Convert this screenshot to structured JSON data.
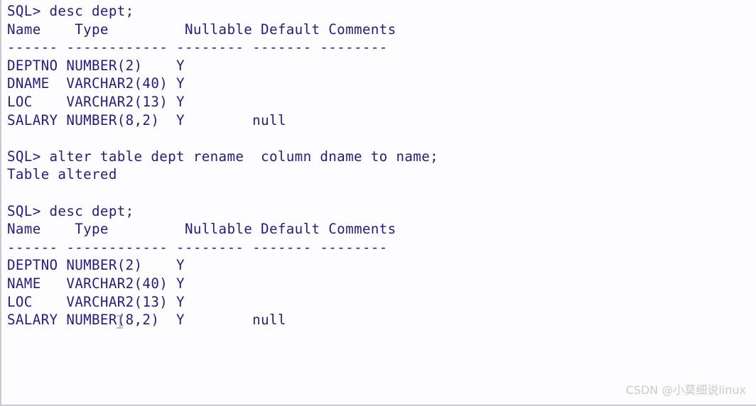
{
  "window": {
    "title": "SQL> console output",
    "background_color": "#fdfdff",
    "text_color": "#2a1a7a",
    "border_color": "#c9c9d2"
  },
  "console": {
    "prompt": "SQL>",
    "table_name": "dept",
    "columns": [
      "Name",
      "Type",
      "Nullable",
      "Default",
      "Comments"
    ],
    "blocks": [
      {
        "type": "command",
        "command": "SQL> desc dept;"
      },
      {
        "type": "describe-output",
        "header": "Name    Type         Nullable Default Comments",
        "separator": "------ ------------ -------- ------- --------",
        "rows": [
          {
            "name": "DEPTNO",
            "type": "NUMBER(2)",
            "nullable": "Y",
            "default": "",
            "comments": ""
          },
          {
            "name": "DNAME",
            "type": "VARCHAR2(40)",
            "nullable": "Y",
            "default": "",
            "comments": ""
          },
          {
            "name": "LOC",
            "type": "VARCHAR2(13)",
            "nullable": "Y",
            "default": "",
            "comments": ""
          },
          {
            "name": "SALARY",
            "type": "NUMBER(8,2)",
            "nullable": "Y",
            "default": "null",
            "comments": ""
          }
        ]
      },
      {
        "type": "command",
        "command": "SQL> alter table dept rename  column dname to name;"
      },
      {
        "type": "result",
        "message": "Table altered"
      },
      {
        "type": "command",
        "command": "SQL> desc dept;"
      },
      {
        "type": "describe-output",
        "header": "Name    Type         Nullable Default Comments",
        "separator": "------ ------------ -------- ------- --------",
        "rows": [
          {
            "name": "DEPTNO",
            "type": "NUMBER(2)",
            "nullable": "Y",
            "default": "",
            "comments": ""
          },
          {
            "name": "NAME",
            "type": "VARCHAR2(40)",
            "nullable": "Y",
            "default": "",
            "comments": ""
          },
          {
            "name": "LOC",
            "type": "VARCHAR2(13)",
            "nullable": "Y",
            "default": "",
            "comments": ""
          },
          {
            "name": "SALARY",
            "type": "NUMBER(8,2)",
            "nullable": "Y",
            "default": "null",
            "comments": ""
          }
        ]
      }
    ],
    "full_text": "SQL> desc dept;\nName    Type         Nullable Default Comments\n------ ------------ -------- ------- --------\nDEPTNO NUMBER(2)    Y\nDNAME  VARCHAR2(40) Y\nLOC    VARCHAR2(13) Y\nSALARY NUMBER(8,2)  Y        null\n\nSQL> alter table dept rename  column dname to name;\nTable altered\n\nSQL> desc dept;\nName    Type         Nullable Default Comments\n------ ------------ -------- ------- --------\nDEPTNO NUMBER(2)    Y\nNAME   VARCHAR2(40) Y\nLOC    VARCHAR2(13) Y\nSALARY NUMBER(8,2)  Y        null"
  },
  "watermark": {
    "text": "CSDN @小莫细说linux",
    "color": "#c9c9cf"
  }
}
